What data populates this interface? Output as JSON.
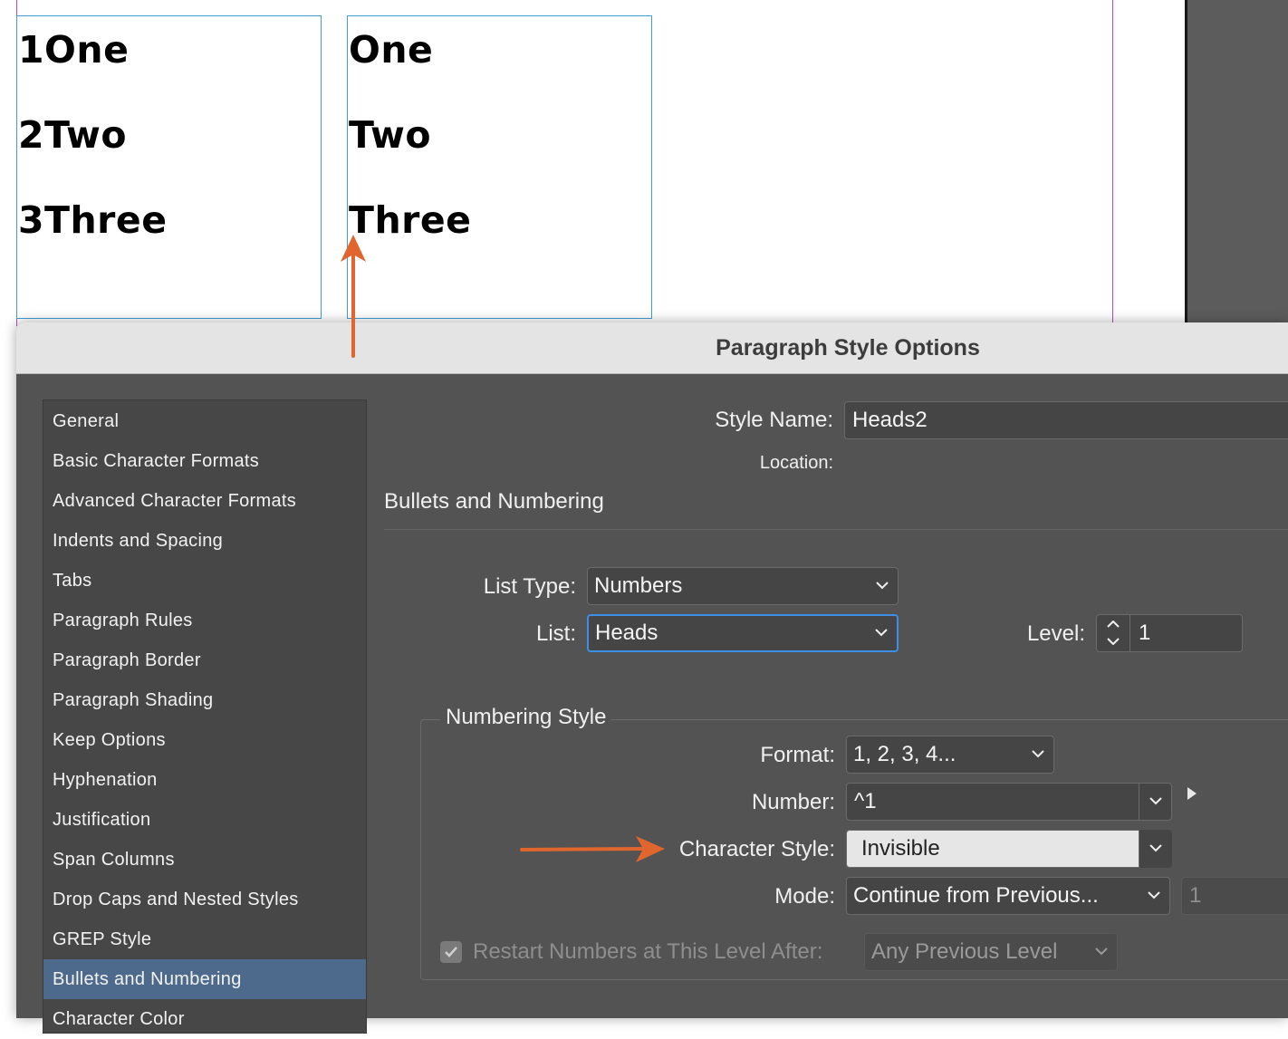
{
  "document": {
    "frame_left": {
      "lines": [
        "1One",
        "2Two",
        "3Three"
      ]
    },
    "frame_right": {
      "lines": [
        "One",
        "Two",
        "Three"
      ]
    }
  },
  "annotations": {
    "arrow_color": "#e0662d"
  },
  "dialog": {
    "title": "Paragraph Style Options",
    "sidebar": {
      "items": [
        {
          "label": "General"
        },
        {
          "label": "Basic Character Formats"
        },
        {
          "label": "Advanced Character Formats"
        },
        {
          "label": "Indents and Spacing"
        },
        {
          "label": "Tabs"
        },
        {
          "label": "Paragraph Rules"
        },
        {
          "label": "Paragraph Border"
        },
        {
          "label": "Paragraph Shading"
        },
        {
          "label": "Keep Options"
        },
        {
          "label": "Hyphenation"
        },
        {
          "label": "Justification"
        },
        {
          "label": "Span Columns"
        },
        {
          "label": "Drop Caps and Nested Styles"
        },
        {
          "label": "GREP Style"
        },
        {
          "label": "Bullets and Numbering"
        },
        {
          "label": "Character Color"
        }
      ],
      "selected": "Bullets and Numbering"
    },
    "style_name_label": "Style Name:",
    "style_name_value": "Heads2",
    "location_label": "Location:",
    "section_title": "Bullets and Numbering",
    "list_type_label": "List Type:",
    "list_type_value": "Numbers",
    "list_label": "List:",
    "list_value": "Heads",
    "level_label": "Level:",
    "level_value": "1",
    "numbering_style": {
      "title": "Numbering Style",
      "format_label": "Format:",
      "format_value": "1, 2, 3, 4...",
      "number_label": "Number:",
      "number_value": "^1",
      "char_style_label": "Character Style:",
      "char_style_value": "Invisible",
      "mode_label": "Mode:",
      "mode_value": "Continue from Previous...",
      "mode_start_value": "1",
      "restart_label": "Restart Numbers at This Level After:",
      "restart_value": "Any Previous Level",
      "restart_checked": true
    }
  }
}
